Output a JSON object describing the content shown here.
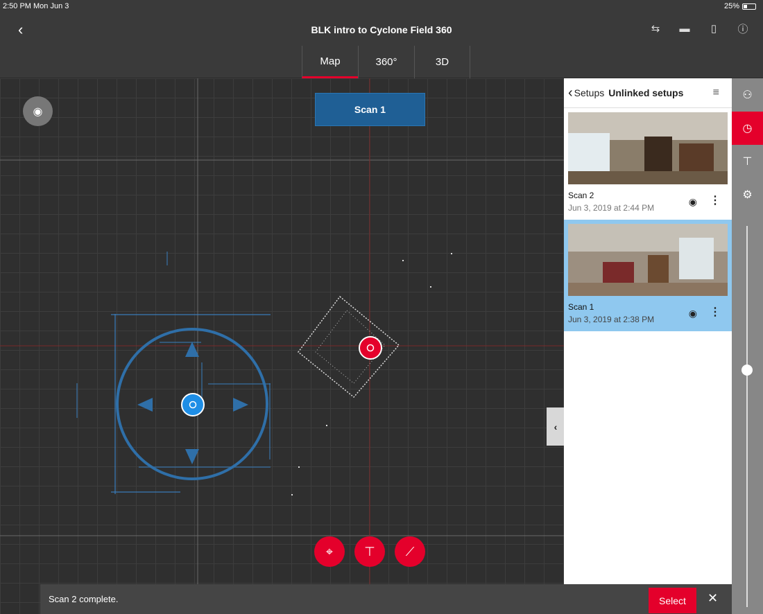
{
  "status_bar": {
    "time": "2:50 PM  Mon Jun 3",
    "battery": "25%"
  },
  "header": {
    "back_icon": "chevron-left-icon",
    "title": "BLK intro to Cyclone Field 360",
    "icons": [
      "sync-icon",
      "device-icon",
      "usb-icon",
      "info-icon"
    ]
  },
  "tabs": [
    {
      "label": "Map",
      "active": true
    },
    {
      "label": "360°",
      "active": false
    },
    {
      "label": "3D",
      "active": false
    }
  ],
  "map": {
    "scan_label": "Scan 1",
    "tools": [
      "locate-icon",
      "pin-icon",
      "measure-icon"
    ]
  },
  "panel": {
    "back_label": "Setups",
    "title": "Unlinked setups",
    "setups": [
      {
        "name": "Scan 2",
        "date": "Jun 3, 2019 at 2:44 PM",
        "selected": false
      },
      {
        "name": "Scan 1",
        "date": "Jun 3, 2019 at 2:38 PM",
        "selected": true
      }
    ]
  },
  "side_rail": {
    "buttons": [
      "layers-icon",
      "compass-icon",
      "pin-icon",
      "settings-icon"
    ],
    "active": "compass-icon",
    "slider_level": 0.37
  },
  "toast": {
    "message": "Scan 2 complete.",
    "select_label": "Select"
  },
  "colors": {
    "accent": "#e4002b",
    "scan_blue": "#1f5f95",
    "selected": "#8fc8ef"
  }
}
